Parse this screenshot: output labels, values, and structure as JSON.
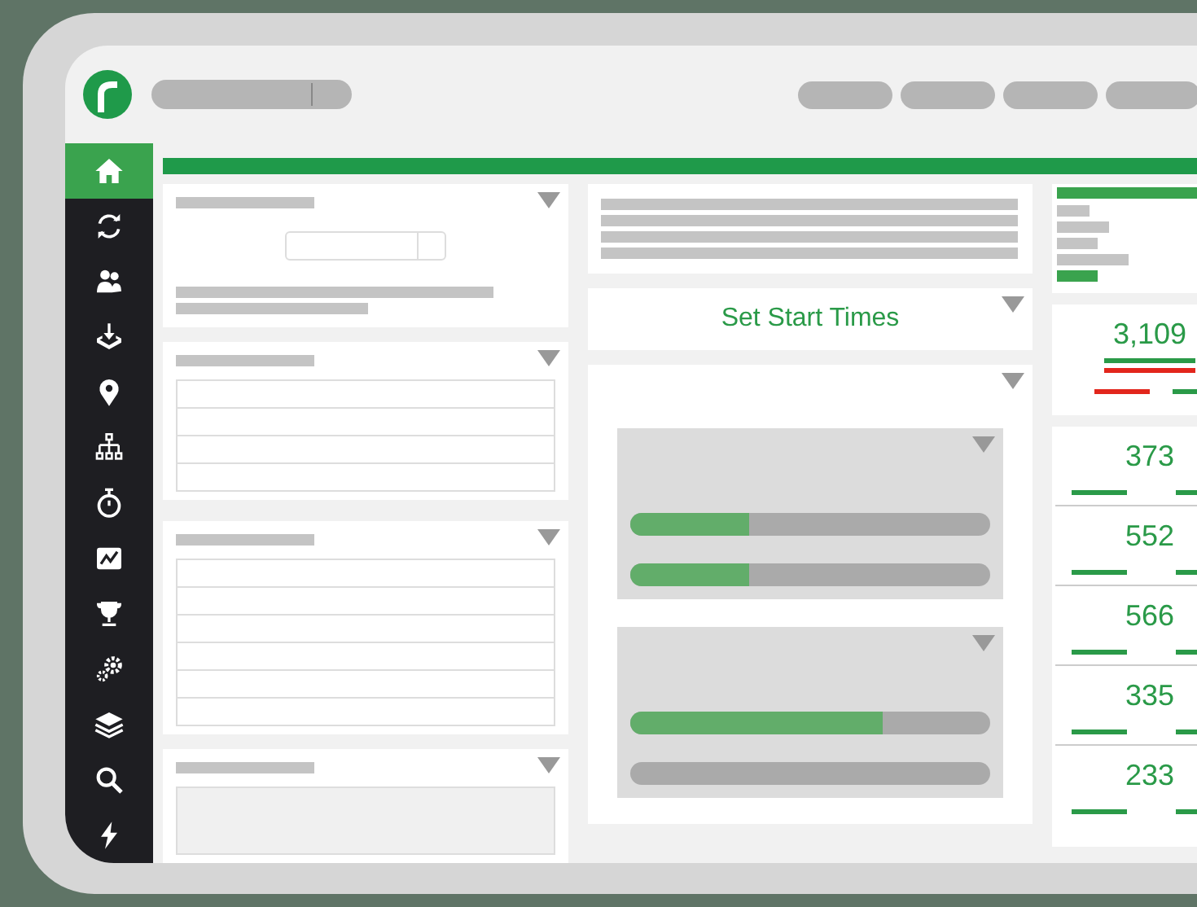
{
  "nav": [
    {
      "selected": true
    },
    {
      "selected": false
    },
    {
      "selected": false
    },
    {
      "selected": false
    },
    {
      "selected": false
    },
    {
      "selected": false
    },
    {
      "selected": false
    },
    {
      "selected": false
    },
    {
      "selected": false
    },
    {
      "selected": false
    },
    {
      "selected": false
    },
    {
      "selected": false
    },
    {
      "selected": false
    }
  ],
  "action_card": {
    "label": "Set Start Times"
  },
  "progress_panels": [
    {
      "bars": [
        {
          "level": 0.33
        },
        {
          "level": 0.33
        }
      ]
    },
    {
      "bars": [
        {
          "level": 0.7
        },
        {
          "level": 0
        }
      ]
    }
  ],
  "total": {
    "value": "3,109"
  },
  "counts": [
    {
      "value": "373"
    },
    {
      "value": "552"
    },
    {
      "value": "566"
    },
    {
      "value": "335"
    },
    {
      "value": "233"
    }
  ]
}
